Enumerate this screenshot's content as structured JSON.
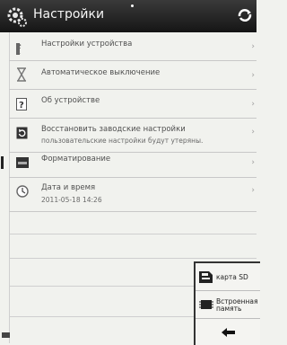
{
  "header": {
    "title": "Настройки",
    "gear_icon": "gear-icon",
    "sync_icon": "sync-icon"
  },
  "menu": [
    {
      "label": "Настройки устройства",
      "icon": "font-f-icon"
    },
    {
      "label": "Автоматическое выключение",
      "icon": "hourglass-icon"
    },
    {
      "label": "Об устройстве",
      "icon": "question-icon"
    },
    {
      "label": "Восстановить заводские настройки",
      "sub": "пользовательские настройки будут утеряны.",
      "icon": "restore-icon"
    },
    {
      "label": "Форматирование",
      "icon": "format-icon"
    },
    {
      "label": "Дата и время",
      "sub": "2011-05-18 14:26",
      "icon": "clock-icon"
    }
  ],
  "chevron": "›",
  "popup": {
    "items": [
      {
        "label": "карта SD",
        "icon": "sd-card-icon"
      },
      {
        "label": "Встроенная память",
        "icon": "memory-chip-icon"
      },
      {
        "label": "",
        "icon": "back-arrow-icon"
      }
    ]
  }
}
